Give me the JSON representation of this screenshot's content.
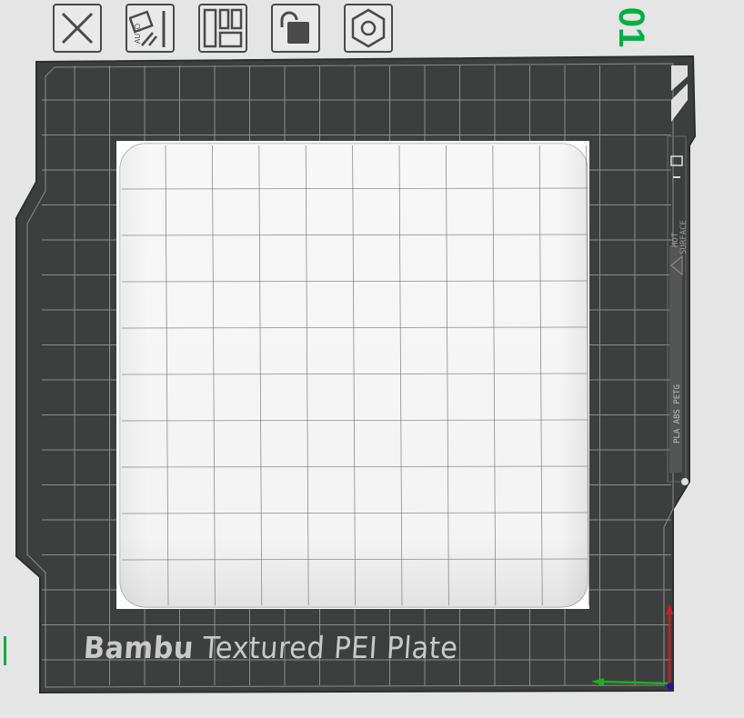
{
  "toolbar": {
    "buttons": [
      {
        "name": "delete-button",
        "icon": "close-icon"
      },
      {
        "name": "auto-orient-button",
        "icon": "auto-orient-icon",
        "label": "AUTO"
      },
      {
        "name": "arrange-button",
        "icon": "arrange-icon"
      },
      {
        "name": "lock-button",
        "icon": "lock-icon"
      },
      {
        "name": "settings-button",
        "icon": "hex-nut-icon"
      }
    ]
  },
  "plate": {
    "number": "01",
    "brand": "Bambu",
    "label": " Textured PEI Plate",
    "side_text_hot": "HOT",
    "side_text_surface": "SURFACE",
    "side_text_materials": "PLA ABS PETG"
  },
  "colors": {
    "background": "#e5e5e5",
    "bed": "#3d3f3e",
    "accent": "#00ae42",
    "axis_x": "#1cb11c",
    "axis_y": "#c62020",
    "axis_origin": "#1a1a9a"
  }
}
